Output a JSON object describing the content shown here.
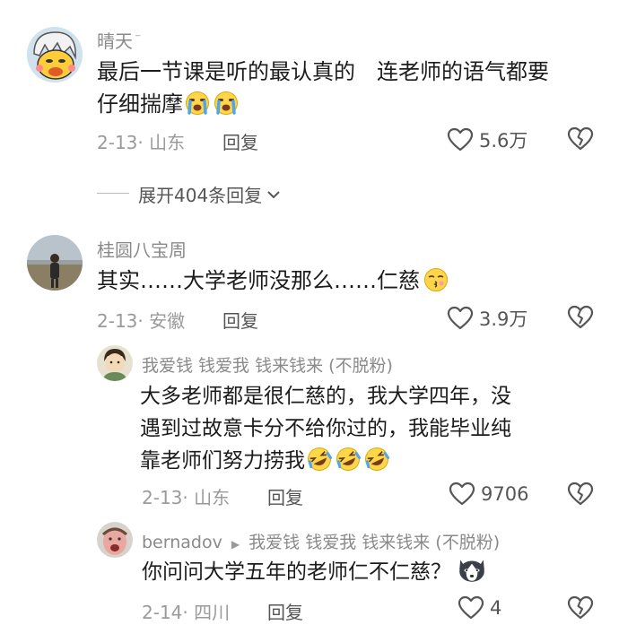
{
  "comments": [
    {
      "user": "晴天",
      "user_suffix": "⁻",
      "text": "最后一节课是听的最认真的　连老师的语气都要仔细揣摩",
      "text_lines": [
        "最后一节课是听的最认真的　连老师的语气都要",
        "仔细揣摩"
      ],
      "date_location": "2-13· 山东",
      "reply_label": "回复",
      "likes": "5.6万",
      "emoji": [
        "crying-face",
        "crying-face"
      ]
    },
    {
      "user": "桂圆八宝周",
      "text": "其实……大学老师没那么……仁慈",
      "date_location": "2-13· 安徽",
      "reply_label": "回复",
      "likes": "3.9万",
      "emoji": [
        "kissing-face"
      ]
    }
  ],
  "expand": {
    "label": "展开404条回复"
  },
  "replies": [
    {
      "user": "我爱钱 钱爱我 钱来钱来 (不脱粉)",
      "text_lines": [
        "大多老师都是很仁慈的，我大学四年，没",
        "遇到过故意卡分不给你过的，我能毕业纯",
        "靠老师们努力捞我"
      ],
      "date_location": "2-13· 山东",
      "reply_label": "回复",
      "likes": "9706",
      "emoji": [
        "rolling-laughing-face",
        "rolling-laughing-face",
        "rolling-laughing-face"
      ]
    },
    {
      "user": "bernadov",
      "reply_to": "我爱钱 钱爱我 钱来钱来 (不脱粉)",
      "text": "你问问大学五年的老师仁不仁慈？",
      "date_location": "2-14· 四川",
      "reply_label": "回复",
      "likes": "4",
      "emoji": [
        "husky-dog-face"
      ]
    }
  ],
  "colors": {
    "name": "#8a8a8a",
    "text": "#1c1c1c",
    "meta": "#9a9a9a",
    "icon": "#555555"
  }
}
